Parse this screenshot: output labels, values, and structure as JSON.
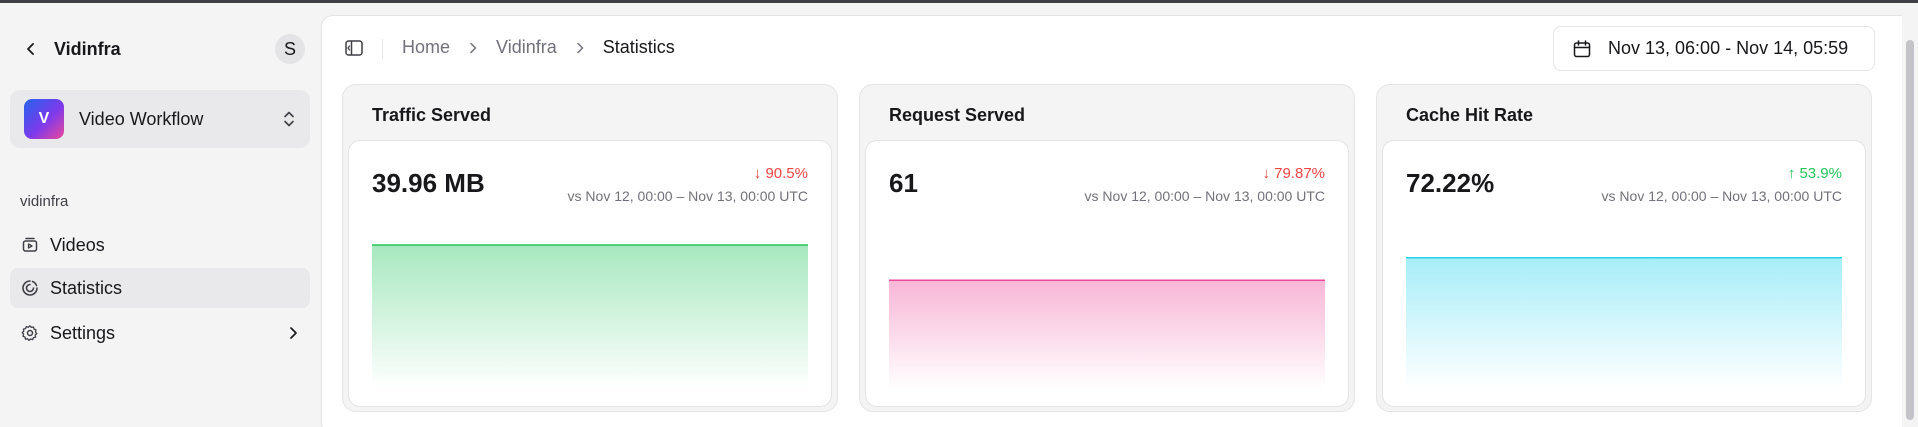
{
  "sidebar": {
    "title": "Vidinfra",
    "avatar_initial": "S",
    "workspace": {
      "logo_letter": "V",
      "name": "Video Workflow"
    },
    "group_label": "vidinfra",
    "nav": [
      {
        "label": "Videos",
        "icon": "video-library-icon",
        "active": false
      },
      {
        "label": "Statistics",
        "icon": "chart-pie-icon",
        "active": true
      },
      {
        "label": "Settings",
        "icon": "gear-icon",
        "active": false,
        "has_submenu": true
      }
    ]
  },
  "header": {
    "breadcrumb": [
      "Home",
      "Vidinfra",
      "Statistics"
    ],
    "date_range": "Nov 13, 06:00 - Nov 14, 05:59"
  },
  "cards": [
    {
      "title": "Traffic Served",
      "value": "39.96 MB",
      "delta": "90.5%",
      "direction": "down",
      "compare": "vs Nov 12, 00:00 – Nov 13, 00:00 UTC",
      "color": "#22c55e",
      "level": 0.9
    },
    {
      "title": "Request Served",
      "value": "61",
      "delta": "79.87%",
      "direction": "down",
      "compare": "vs Nov 12, 00:00 – Nov 13, 00:00 UTC",
      "color": "#ec4899",
      "level": 0.68
    },
    {
      "title": "Cache Hit Rate",
      "value": "72.22%",
      "delta": "53.9%",
      "direction": "up",
      "compare": "vs Nov 12, 00:00 – Nov 13, 00:00 UTC",
      "color": "#22d3ee",
      "level": 0.82
    }
  ],
  "colors": {
    "down": "#ef4444",
    "up": "#22c55e",
    "accent": "#7c3aed"
  }
}
